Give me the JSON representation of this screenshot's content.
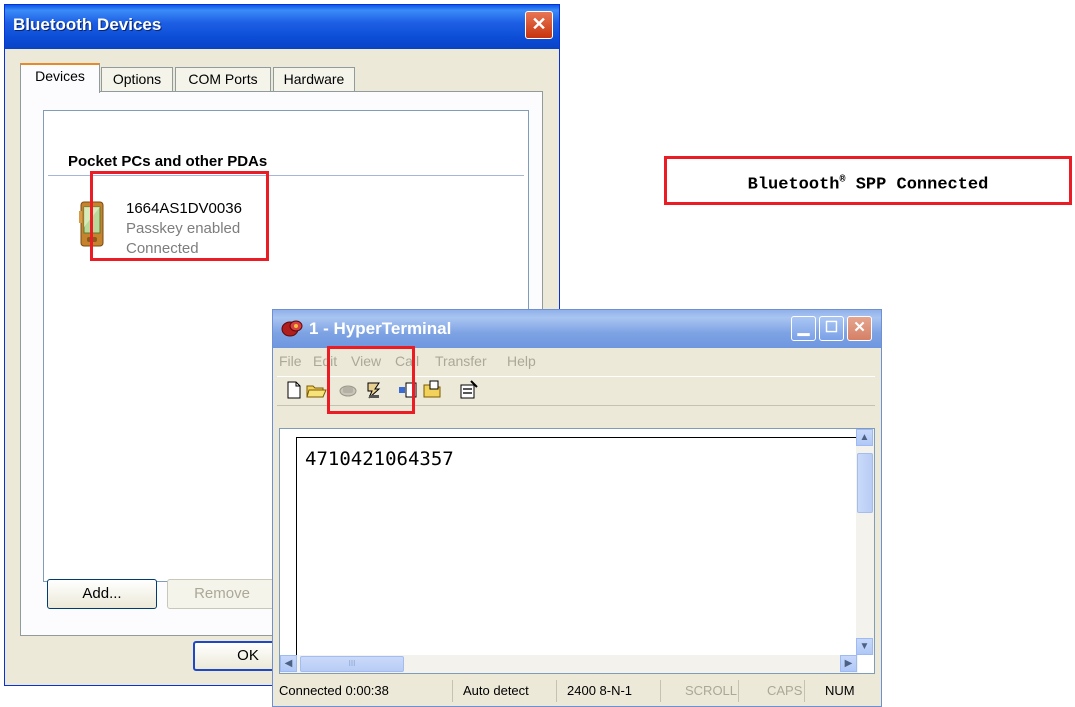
{
  "bluetooth_window": {
    "title": "Bluetooth Devices",
    "close_glyph": "✕",
    "tabs": [
      {
        "label": "Devices",
        "active": true
      },
      {
        "label": "Options",
        "active": false
      },
      {
        "label": "COM Ports",
        "active": false
      },
      {
        "label": "Hardware",
        "active": false
      }
    ],
    "group_heading": "Pocket PCs and other PDAs",
    "device": {
      "name": "1664AS1DV0036",
      "passkey_status": "Passkey enabled",
      "connection_status": "Connected",
      "icon": "pda-icon"
    },
    "buttons": {
      "add": "Add...",
      "remove": "Remove",
      "ok": "OK"
    }
  },
  "callout": {
    "text_before": "Bluetooth",
    "superscript": "®",
    "text_after": " SPP Connected"
  },
  "hyperterminal": {
    "title": "1 - HyperTerminal",
    "caption_buttons": {
      "minimize": "▁",
      "maximize": "☐",
      "close": "✕"
    },
    "menu": [
      "File",
      "Edit",
      "View",
      "Call",
      "Transfer",
      "Help"
    ],
    "toolbar_icons": [
      "new-icon",
      "open-icon",
      "call-icon",
      "disconnect-icon",
      "send-icon",
      "receive-icon",
      "properties-icon"
    ],
    "terminal_text": "4710421064357",
    "status": {
      "connected_time": "Connected 0:00:38",
      "detect": "Auto detect",
      "settings": "2400 8-N-1",
      "scroll": "SCROLL",
      "caps": "CAPS",
      "num": "NUM"
    },
    "scroll_glyphs": {
      "up": "▲",
      "down": "▼",
      "left": "◀",
      "right": "▶",
      "thumb": "III"
    }
  },
  "colors": {
    "highlight": "#ec1c24",
    "xp_title_blue": "#0a4ad4",
    "window_face": "#ece9d8"
  }
}
